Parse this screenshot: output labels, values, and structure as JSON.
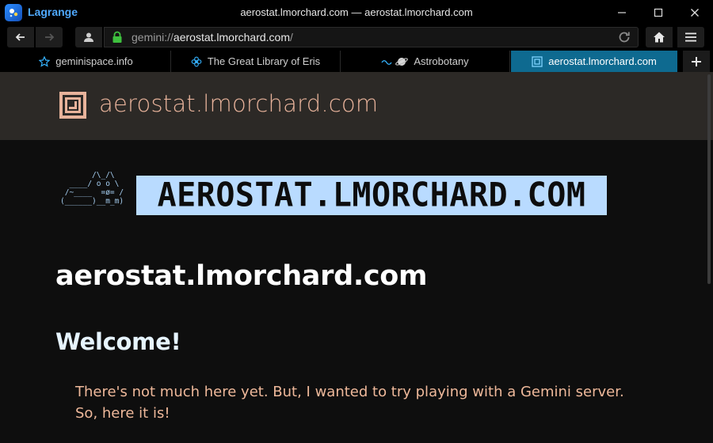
{
  "app": {
    "name": "Lagrange",
    "window_title": "aerostat.lmorchard.com — aerostat.lmorchard.com"
  },
  "nav": {
    "url_scheme": "gemini://",
    "url_host": "aerostat.lmorchard.com",
    "url_path": "/"
  },
  "tabs": [
    {
      "label": "geminispace.info",
      "icon": "star-icon",
      "active": false
    },
    {
      "label": "The Great Library of Eris",
      "icon": "flower-icon",
      "active": false
    },
    {
      "label": "Astrobotany",
      "icon": "planet-icon",
      "active": false
    },
    {
      "label": "aerostat.lmorchard.com",
      "icon": "square-icon",
      "active": true
    }
  ],
  "page": {
    "header_title": "aerostat.lmorchard.com",
    "ascii_art": "       /\\_/\\\n  ____/ o o \\\n /~____  =ø= /\n(______)__m_m)",
    "banner_text": "aerostat.lmorchard.com",
    "h1": "aerostat.lmorchard.com",
    "h2": "Welcome!",
    "paragraph": "There's not much here yet. But, I wanted to try playing with a Gemini server. So, here it is!"
  },
  "colors": {
    "accent": "#0e6a90",
    "link_blue": "#35b3ff",
    "header_text": "#e8b39b",
    "body_text": "#eeb89a",
    "banner_bg": "#b9dbff"
  }
}
